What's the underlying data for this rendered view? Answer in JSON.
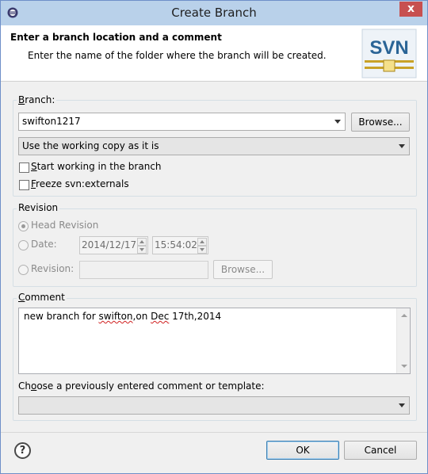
{
  "window": {
    "title": "Create Branch",
    "close_glyph": "x"
  },
  "header": {
    "title": "Enter a branch location and a comment",
    "description": "Enter the name of the folder where the branch will be created.",
    "logo_text": "SVN"
  },
  "branch": {
    "group_label_mn": "B",
    "group_label_rest": "ranch:",
    "location_value": "swifton1217",
    "browse_label": "Browse...",
    "copy_source": "Use the working copy as it is",
    "start_working_mn": "S",
    "start_working_rest": "tart working in the branch",
    "start_working_checked": false,
    "freeze_mn": "F",
    "freeze_rest": "reeze svn:externals",
    "freeze_checked": false
  },
  "revision": {
    "group_label": "Revision",
    "head_label": "Head Revision",
    "date_label": "Date:",
    "date_value": "2014/12/17",
    "time_value": "15:54:02",
    "revision_label": "Revision:",
    "revision_value": "",
    "browse_label": "Browse...",
    "selected": "head"
  },
  "comment": {
    "group_label_mn": "C",
    "group_label_rest": "omment",
    "text_pre": "new branch for ",
    "text_w1": "swifton",
    "text_mid": ",on ",
    "text_w2": "Dec",
    "text_post": " 17th,2014",
    "template_label_pre": "Ch",
    "template_label_mn": "o",
    "template_label_post": "ose a previously entered comment or template:",
    "template_value": ""
  },
  "footer": {
    "help_glyph": "?",
    "ok_label": "OK",
    "cancel_label": "Cancel"
  },
  "colors": {
    "titlebar": "#b9d1ea",
    "close_button": "#c75050",
    "svn_logo": "#2a6496"
  }
}
